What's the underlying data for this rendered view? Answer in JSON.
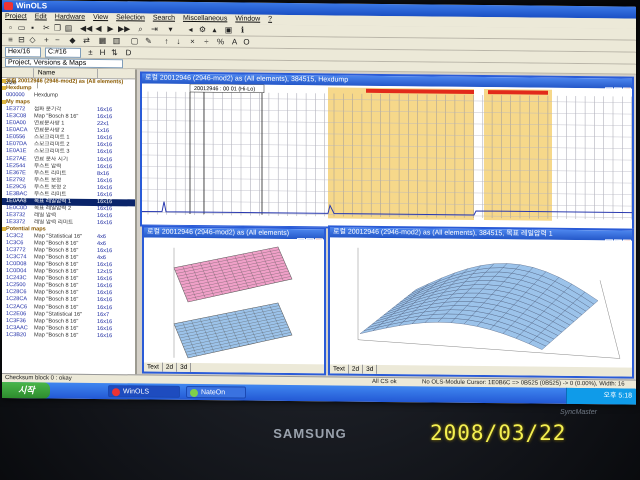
{
  "app": {
    "title": "WinOLS",
    "menu": [
      "Project",
      "Edit",
      "Hardware",
      "View",
      "Selection",
      "Search",
      "Miscellaneous",
      "Window",
      "?"
    ]
  },
  "toolbar": {
    "combo1": "Hex/16",
    "combo2": "C:#16",
    "combo3": "Project, Versions & Maps"
  },
  "left_panel": {
    "columns": [
      "Name",
      "Size"
    ],
    "rows": [
      {
        "addr": "로컬 20012946 (2946-mod2) as (All elements)",
        "name": "",
        "size": "",
        "type": "grp"
      },
      {
        "addr": "Hexdump",
        "name": "",
        "size": "",
        "type": "grp"
      },
      {
        "addr": "000000",
        "name": "Hexdump",
        "size": "",
        "type": "item"
      },
      {
        "addr": "My maps",
        "name": "",
        "size": "",
        "type": "grp"
      },
      {
        "addr": "1E3772",
        "name": "점화 분기각",
        "size": "16x16",
        "type": "item"
      },
      {
        "addr": "1E3C08",
        "name": "Map \"Bosch 8 16\"",
        "size": "16x16",
        "type": "item"
      },
      {
        "addr": "1E0A00",
        "name": "연료분사량 1",
        "size": "22x1",
        "type": "item"
      },
      {
        "addr": "1E0ACA",
        "name": "연료분사량 2",
        "size": "1x16",
        "type": "item"
      },
      {
        "addr": "1E0556",
        "name": "스모크리미트 1",
        "size": "16x16",
        "type": "item"
      },
      {
        "addr": "1E07DA",
        "name": "스모크리미트 2",
        "size": "16x16",
        "type": "item"
      },
      {
        "addr": "1E0A1E",
        "name": "스모크리미트 3",
        "size": "16x16",
        "type": "item"
      },
      {
        "addr": "1E27AE",
        "name": "연료 분사 시기",
        "size": "16x16",
        "type": "item"
      },
      {
        "addr": "1E2544",
        "name": "부스트 압력",
        "size": "16x16",
        "type": "item"
      },
      {
        "addr": "1E367E",
        "name": "부스트 리미트",
        "size": "8x16",
        "type": "item"
      },
      {
        "addr": "1E2792",
        "name": "부스트 보정",
        "size": "16x16",
        "type": "item"
      },
      {
        "addr": "1E29C6",
        "name": "부스트 보정 2",
        "size": "16x16",
        "type": "item"
      },
      {
        "addr": "1E3BAC",
        "name": "부스트 리미트",
        "size": "16x16",
        "type": "item"
      },
      {
        "addr": "1E0AA8",
        "name": "목표 레일압력 1",
        "size": "16x16",
        "type": "sel"
      },
      {
        "addr": "1E0C0D",
        "name": "목표 레일압력 2",
        "size": "16x16",
        "type": "item"
      },
      {
        "addr": "1E3732",
        "name": "레일 압력",
        "size": "16x16",
        "type": "item"
      },
      {
        "addr": "1E3372",
        "name": "레일 압력 리미트",
        "size": "16x16",
        "type": "item"
      },
      {
        "addr": "Potential maps",
        "name": "",
        "size": "",
        "type": "grp"
      },
      {
        "addr": "1C3C2",
        "name": "Map \"Statistical 16\"",
        "size": "4x6",
        "type": "item"
      },
      {
        "addr": "1C3C6",
        "name": "Map \"Bosch 8 16\"",
        "size": "4x6",
        "type": "item"
      },
      {
        "addr": "1C3772",
        "name": "Map \"Bosch 8 16\"",
        "size": "16x16",
        "type": "item"
      },
      {
        "addr": "1C3C74",
        "name": "Map \"Bosch 8 16\"",
        "size": "4x6",
        "type": "item"
      },
      {
        "addr": "1C0D08",
        "name": "Map \"Bosch 8 16\"",
        "size": "16x16",
        "type": "item"
      },
      {
        "addr": "1C0D04",
        "name": "Map \"Bosch 8 16\"",
        "size": "12x15",
        "type": "item"
      },
      {
        "addr": "1C243C",
        "name": "Map \"Bosch 8 16\"",
        "size": "16x16",
        "type": "item"
      },
      {
        "addr": "1C2500",
        "name": "Map \"Bosch 8 16\"",
        "size": "16x16",
        "type": "item"
      },
      {
        "addr": "1C28C6",
        "name": "Map \"Bosch 8 16\"",
        "size": "16x16",
        "type": "item"
      },
      {
        "addr": "1C28CA",
        "name": "Map \"Bosch 8 16\"",
        "size": "16x16",
        "type": "item"
      },
      {
        "addr": "1C2AC6",
        "name": "Map \"Bosch 8 16\"",
        "size": "16x16",
        "type": "item"
      },
      {
        "addr": "1C2E06",
        "name": "Map \"Statistical 16\"",
        "size": "16x7",
        "type": "item"
      },
      {
        "addr": "1C3F36",
        "name": "Map \"Bosch 8 16\"",
        "size": "16x16",
        "type": "item"
      },
      {
        "addr": "1C3AAC",
        "name": "Map \"Bosch 8 16\"",
        "size": "16x16",
        "type": "item"
      },
      {
        "addr": "1C3B20",
        "name": "Map \"Bosch 8 16\"",
        "size": "16x16",
        "type": "item"
      }
    ]
  },
  "hexwin": {
    "title": "로컬 20012946 (2946-mod2) as (All elements), 384515, Hexdump",
    "label": "20012946 : 00 01 (Hi-Lo)"
  },
  "win3d_left": {
    "title": "로컬 20012946 (2946-mod2) as (All elements)",
    "tabs": [
      "Text",
      "2d",
      "3d"
    ]
  },
  "win3d_right": {
    "title": "로컬 20012946 (2946-mod2) as (All elements), 384515, 목표 레일압력 1",
    "tabs": [
      "Text",
      "2d",
      "3d"
    ]
  },
  "statusbar": {
    "left": "Checksum block 0 : okay",
    "middle": "All CS ok",
    "right": "No OLS-Module  Cursor: 1E0B6C => 0B525 (0B525) -> 0 (0.00%), Width: 16"
  },
  "taskbar": {
    "start": "시작",
    "tasks": [
      "WinOLS",
      "NateOn"
    ],
    "clock": "오후 5:18"
  },
  "monitor": {
    "brand": "SAMSUNG",
    "model": "SyncMaster"
  },
  "timestamp": "2008/03/22",
  "colors": {
    "title_blue": "#2457c8",
    "highlight_yellow": "#f6d88a",
    "marker_red": "#e22a1a",
    "surface_blue": "#9cc3ea",
    "surface_pink": "#f0a0c8",
    "stamp_yellow": "#f4f052"
  }
}
